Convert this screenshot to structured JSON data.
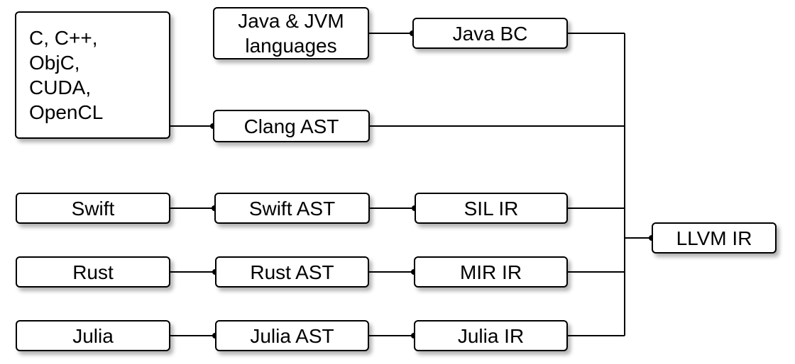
{
  "diagram": {
    "c_family": "C, C++,\nObjC,\nCUDA,\nOpenCL",
    "jvm": "Java & JVM\nlanguages",
    "java_bc": "Java BC",
    "clang_ast": "Clang AST",
    "swift": "Swift",
    "swift_ast": "Swift AST",
    "sil_ir": "SIL IR",
    "rust": "Rust",
    "rust_ast": "Rust AST",
    "mir_ir": "MIR IR",
    "julia": "Julia",
    "julia_ast": "Julia AST",
    "julia_ir": "Julia IR",
    "llvm_ir": "LLVM IR"
  }
}
